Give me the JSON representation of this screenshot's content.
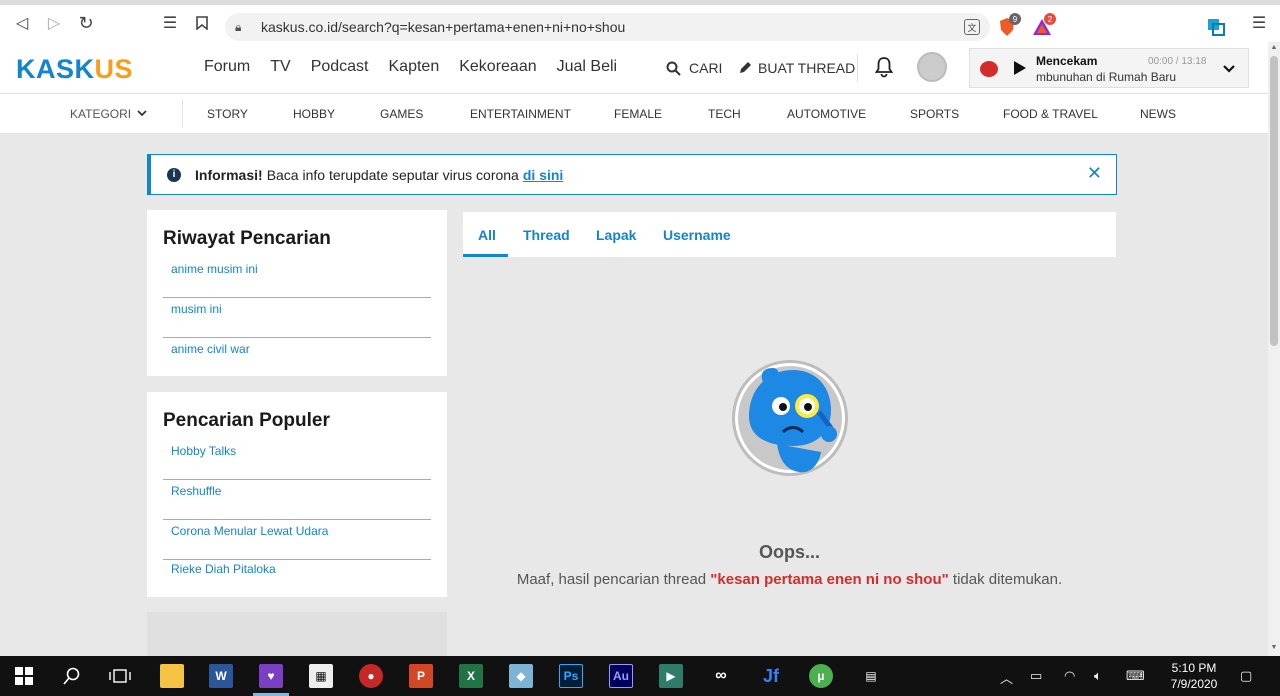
{
  "browser": {
    "url": "kaskus.co.id/search?q=kesan+pertama+enen+ni+no+shou",
    "brave_badge": "9",
    "rewards_badge": "2"
  },
  "header": {
    "logo_a": "KASK",
    "logo_b": "US",
    "nav": [
      "Forum",
      "TV",
      "Podcast",
      "Kapten",
      "Kekoreaan",
      "Jual Beli"
    ],
    "cari": "CARI",
    "buat_thread": "BUAT THREAD",
    "player": {
      "title": "Mencekam",
      "time": "00:00 / 13:18",
      "subtitle": "mbunuhan di Rumah Baru"
    }
  },
  "categories": {
    "label": "KATEGORI",
    "items": [
      "STORY",
      "HOBBY",
      "GAMES",
      "ENTERTAINMENT",
      "FEMALE",
      "TECH",
      "AUTOMOTIVE",
      "SPORTS",
      "FOOD & TRAVEL",
      "NEWS"
    ]
  },
  "banner": {
    "bold": "Informasi!",
    "text": "Baca info terupdate seputar virus corona",
    "link": "di sini"
  },
  "history": {
    "title": "Riwayat Pencarian",
    "items": [
      "anime musim ini",
      "musim ini",
      "anime civil war"
    ]
  },
  "popular": {
    "title": "Pencarian Populer",
    "items": [
      "Hobby Talks",
      "Reshuffle",
      "Corona Menular Lewat Udara",
      "Rieke Diah Pitaloka"
    ]
  },
  "tabs": [
    "All",
    "Thread",
    "Lapak",
    "Username"
  ],
  "result": {
    "oops": "Oops...",
    "msg_before": "Maaf, hasil pencarian thread",
    "keyword": "\"kesan pertama enen ni no shou\"",
    "msg_after": "tidak ditemukan."
  },
  "taskbar": {
    "time": "5:10 PM",
    "date": "7/9/2020"
  },
  "colors": {
    "brand_blue": "#1484ce",
    "brand_orange": "#f99e1c",
    "keyword_red": "#d62b2b"
  }
}
